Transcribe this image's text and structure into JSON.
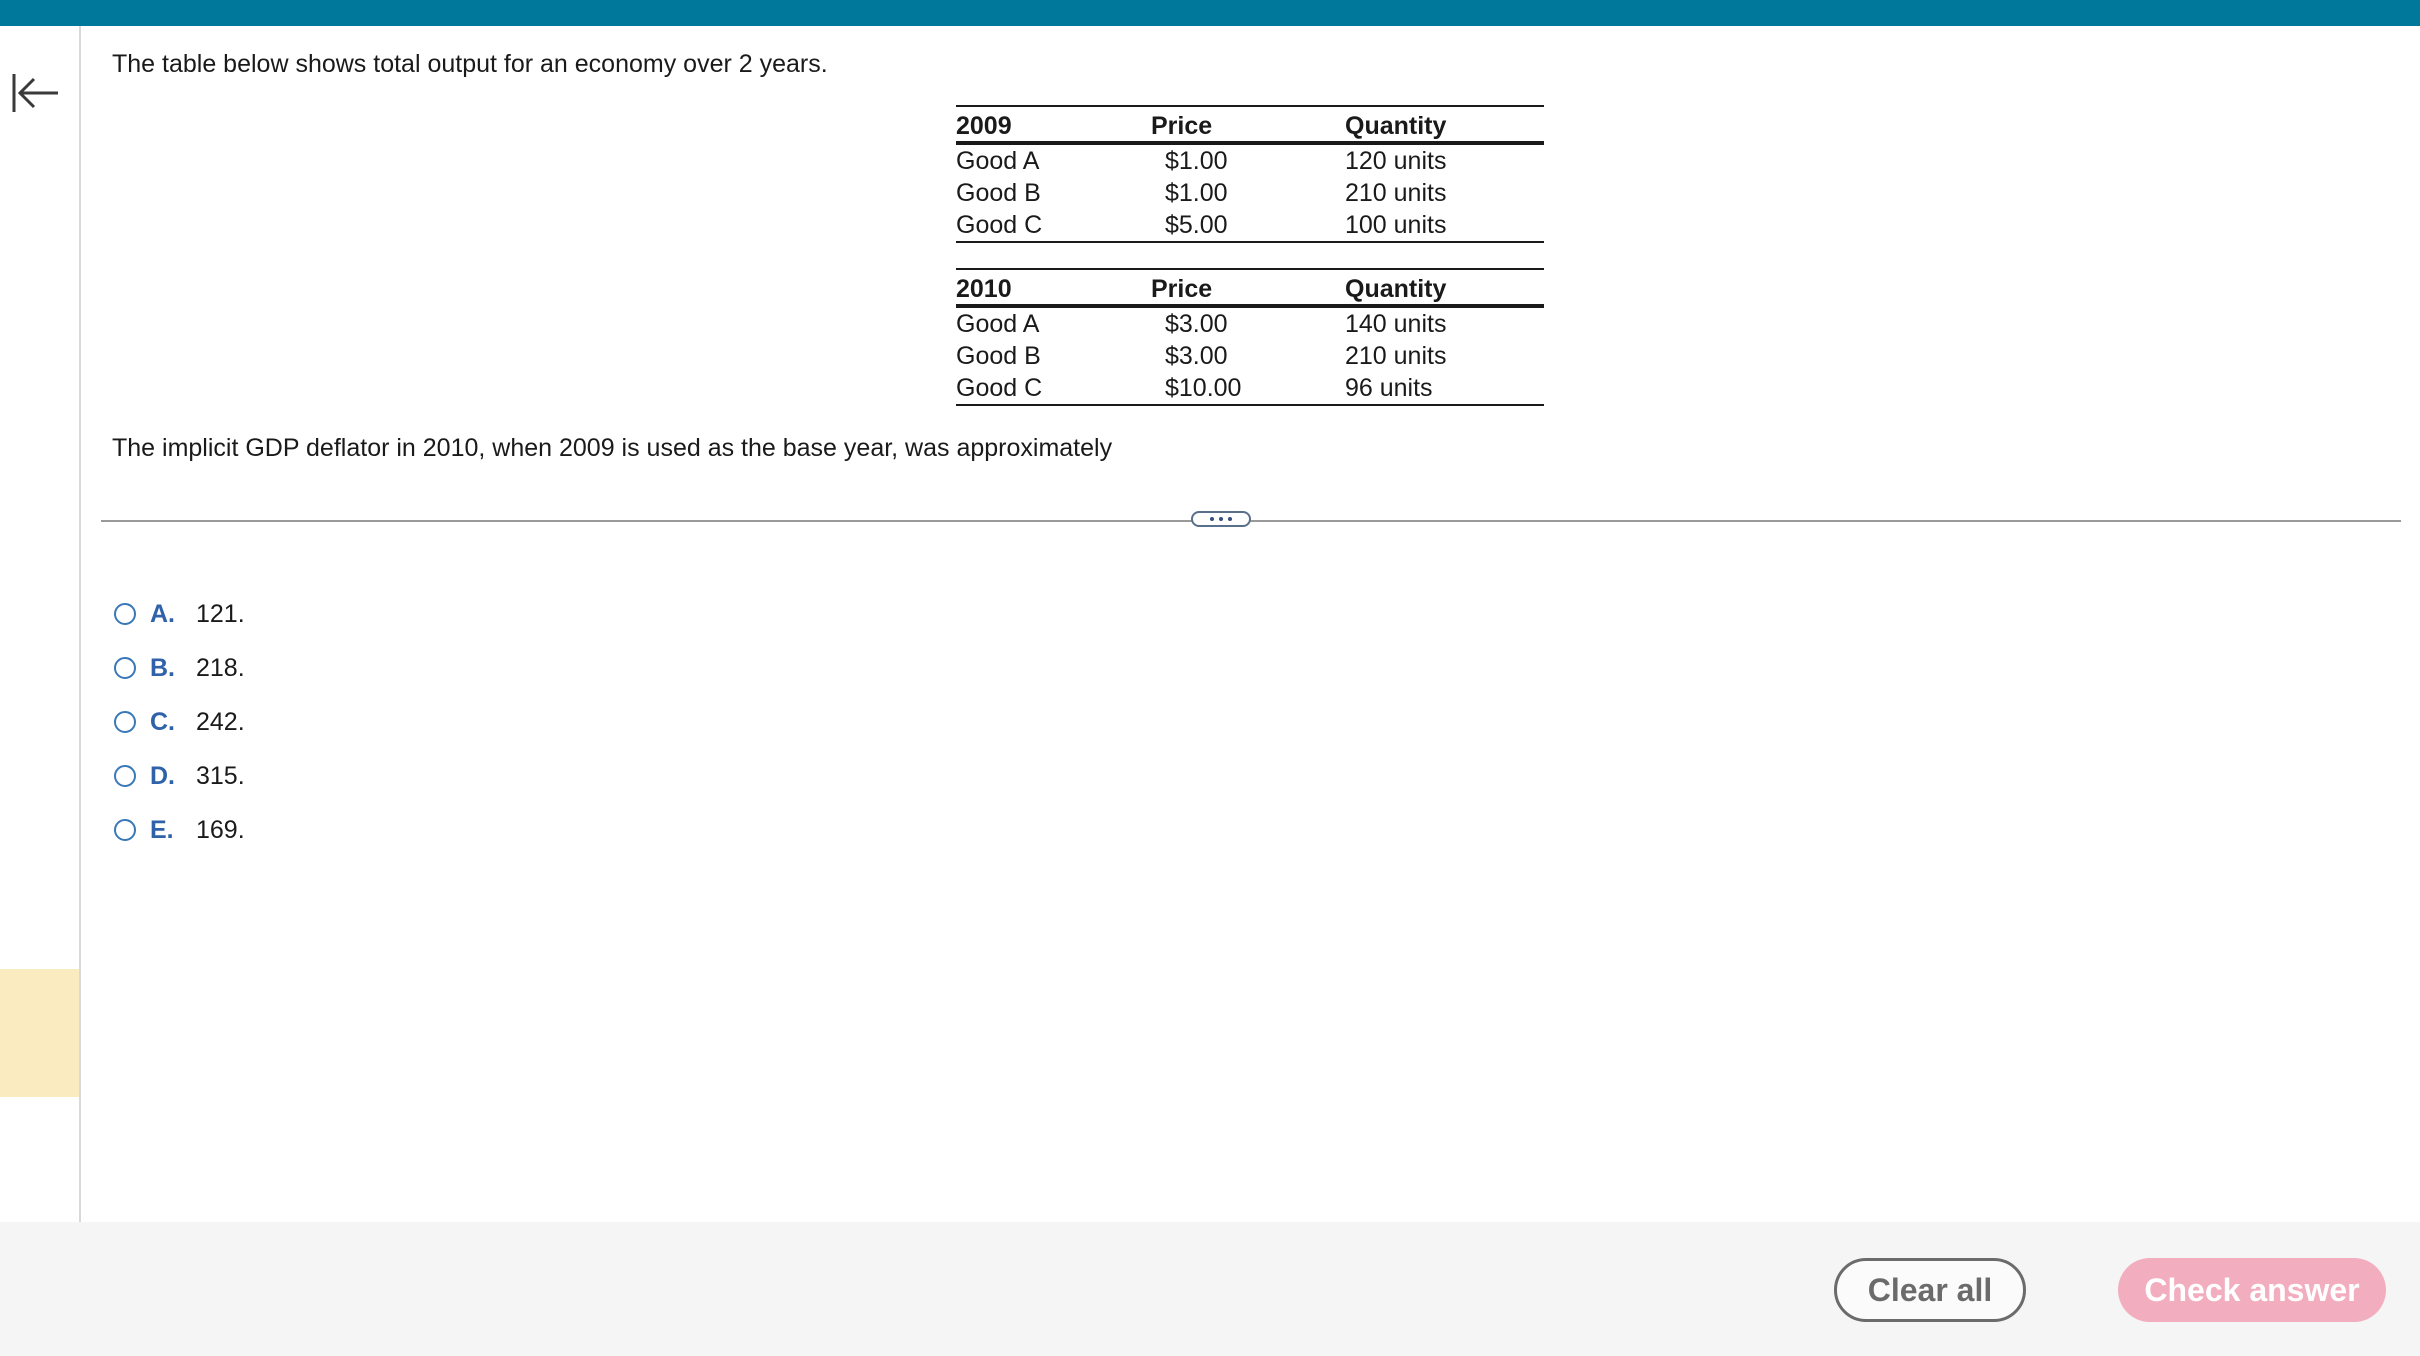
{
  "question": {
    "intro": "The table below shows total output for an economy over 2 years.",
    "prompt": "The implicit GDP deflator in 2010, when 2009 is used as the base year, was approximately"
  },
  "tables": [
    {
      "headers": [
        "2009",
        "Price",
        "Quantity"
      ],
      "rows": [
        [
          "Good A",
          "$1.00",
          "120 units"
        ],
        [
          "Good B",
          "$1.00",
          "210 units"
        ],
        [
          "Good C",
          "$5.00",
          "100 units"
        ]
      ]
    },
    {
      "headers": [
        "2010",
        "Price",
        "Quantity"
      ],
      "rows": [
        [
          "Good A",
          "$3.00",
          "140 units"
        ],
        [
          "Good B",
          "$3.00",
          "210 units"
        ],
        [
          "Good C",
          "$10.00",
          "96 units"
        ]
      ]
    }
  ],
  "choices": [
    {
      "letter": "A.",
      "text": "121."
    },
    {
      "letter": "B.",
      "text": "218."
    },
    {
      "letter": "C.",
      "text": "242."
    },
    {
      "letter": "D.",
      "text": "315."
    },
    {
      "letter": "E.",
      "text": "169."
    }
  ],
  "footer": {
    "clear_label": "Clear all",
    "check_label": "Check answer"
  },
  "icons": {
    "collapse": "arrow-left-to-bar-icon",
    "expand": "more-horizontal-icon"
  },
  "colors": {
    "top_bar": "#00789b",
    "choice_letter": "#2f62a9",
    "check_button": "#f2aebe",
    "highlight": "#faebc0"
  }
}
